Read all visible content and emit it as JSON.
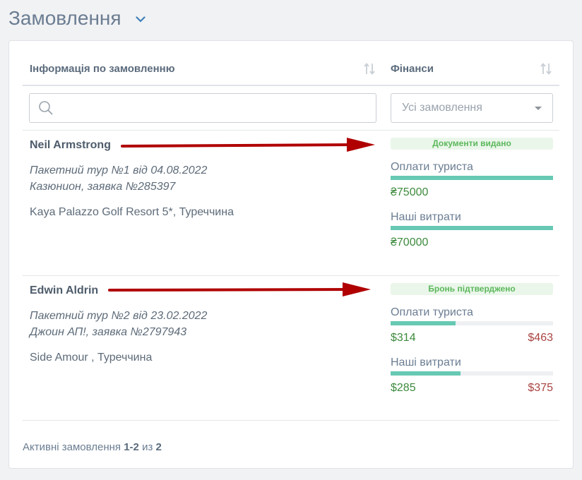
{
  "header": {
    "title": "Замовлення"
  },
  "table": {
    "col_info": "Інформація по замовленню",
    "col_finance": "Фінанси",
    "search": {
      "value": "",
      "placeholder": ""
    },
    "filter": {
      "selected": "Усі замовлення"
    }
  },
  "orders": [
    {
      "client": "Neil Armstrong",
      "tour": "Пакетний тур №1 від 04.08.2022",
      "operator": "Казюнион, заявка №285397",
      "hotel": "Kaya Palazzo Golf Resort 5*, Туреччина",
      "status": "Документи видано",
      "tourist_payments_label": "Оплати туриста",
      "tourist_payments_paid": "₴75000",
      "tourist_payments_total": "",
      "tourist_payments_progress": 1.0,
      "our_costs_label": "Наші витрати",
      "our_costs_paid": "₴70000",
      "our_costs_total": "",
      "our_costs_progress": 1.0
    },
    {
      "client": "Edwin Aldrin",
      "tour": "Пакетний тур №2 від 23.02.2022",
      "operator": "Джоин АП!, заявка №2797943",
      "hotel": "Side Amour , Туреччина",
      "status": "Бронь підтверджено",
      "tourist_payments_label": "Оплати туриста",
      "tourist_payments_paid": "$314",
      "tourist_payments_total": "$463",
      "tourist_payments_progress": 0.4,
      "our_costs_label": "Наші витрати",
      "our_costs_paid": "$285",
      "our_costs_total": "$375",
      "our_costs_progress": 0.43
    }
  ],
  "footer": {
    "prefix": "Активні замовлення",
    "range": "1-2",
    "sep": "из",
    "count": "2"
  },
  "colors": {
    "accent": "#67c9b3",
    "paid": "#3d8a3d",
    "due": "#a94442",
    "arrow": "#b00000"
  }
}
